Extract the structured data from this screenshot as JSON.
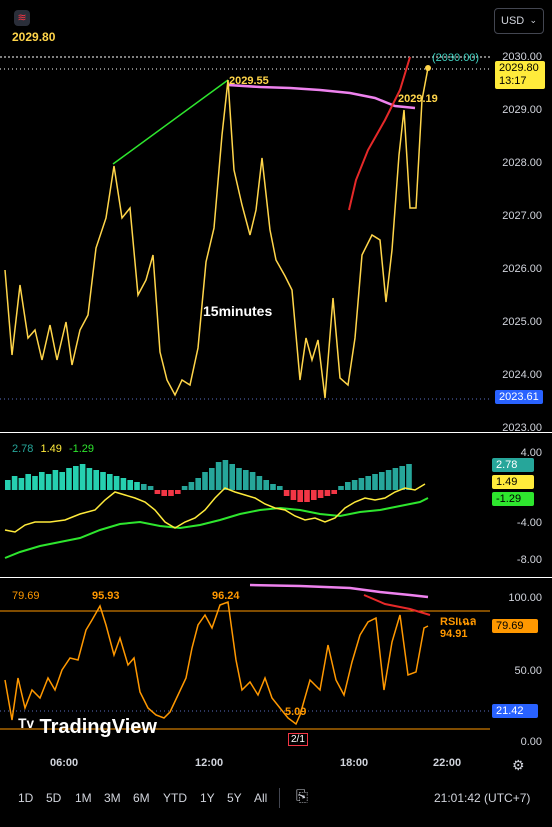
{
  "header": {
    "last_price": "2029.80",
    "currency": "USD",
    "logo_icon": "tradingview-logo-icon"
  },
  "price_pane": {
    "axis_ticks": [
      "2030.00",
      "2029.00",
      "2028.00",
      "2027.00",
      "2026.00",
      "2025.00",
      "2024.00",
      "2023.00"
    ],
    "current_price": "2029.80",
    "countdown": "13:17",
    "target_label": "(2030.00)",
    "low_price_tag": "2023.61",
    "annotation_high": "2029.55",
    "annotation_recent": "2029.19",
    "timeframe_note": "15minutes"
  },
  "macd_pane": {
    "legend": {
      "v1": "2.78",
      "v2": "1.49",
      "v3": "-1.29"
    },
    "axis_ticks": [
      "4.00",
      "-4.00",
      "-8.00"
    ],
    "tags": {
      "t1": "2.78",
      "t2": "1.49",
      "t3": "-1.29"
    }
  },
  "rsi_pane": {
    "value_label": "79.69",
    "axis_ticks": [
      "100.00",
      "50.00",
      "0.00"
    ],
    "tag_value": "79.69",
    "tag_lower": "21.42",
    "peak1": "95.93",
    "peak2": "96.24",
    "trough": "5.09",
    "rsi_label": "RSIเฉล",
    "rsi_value": "94.91",
    "marker": "2/1",
    "watermark": "TradingView"
  },
  "time_axis": [
    "06:00",
    "12:00",
    "18:00",
    "22:00"
  ],
  "bottom_bar": {
    "ranges": [
      "1D",
      "5D",
      "1M",
      "3M",
      "6M",
      "YTD",
      "1Y",
      "5Y",
      "All"
    ],
    "clock": "21:01:42 (UTC+7)",
    "compare_icon": "calendar-range-icon",
    "settings_icon": "gear-icon"
  },
  "colors": {
    "price_line": "#ffd54a",
    "trend_green": "#2ee62e",
    "trend_red": "#e62929",
    "ma_pink": "#ee82ee",
    "macd_signal": "#2ee62e",
    "rsi_line": "#ff9800",
    "axis_tag_yellow": "#ffeb3b",
    "low_tag_blue": "#2962ff"
  }
}
